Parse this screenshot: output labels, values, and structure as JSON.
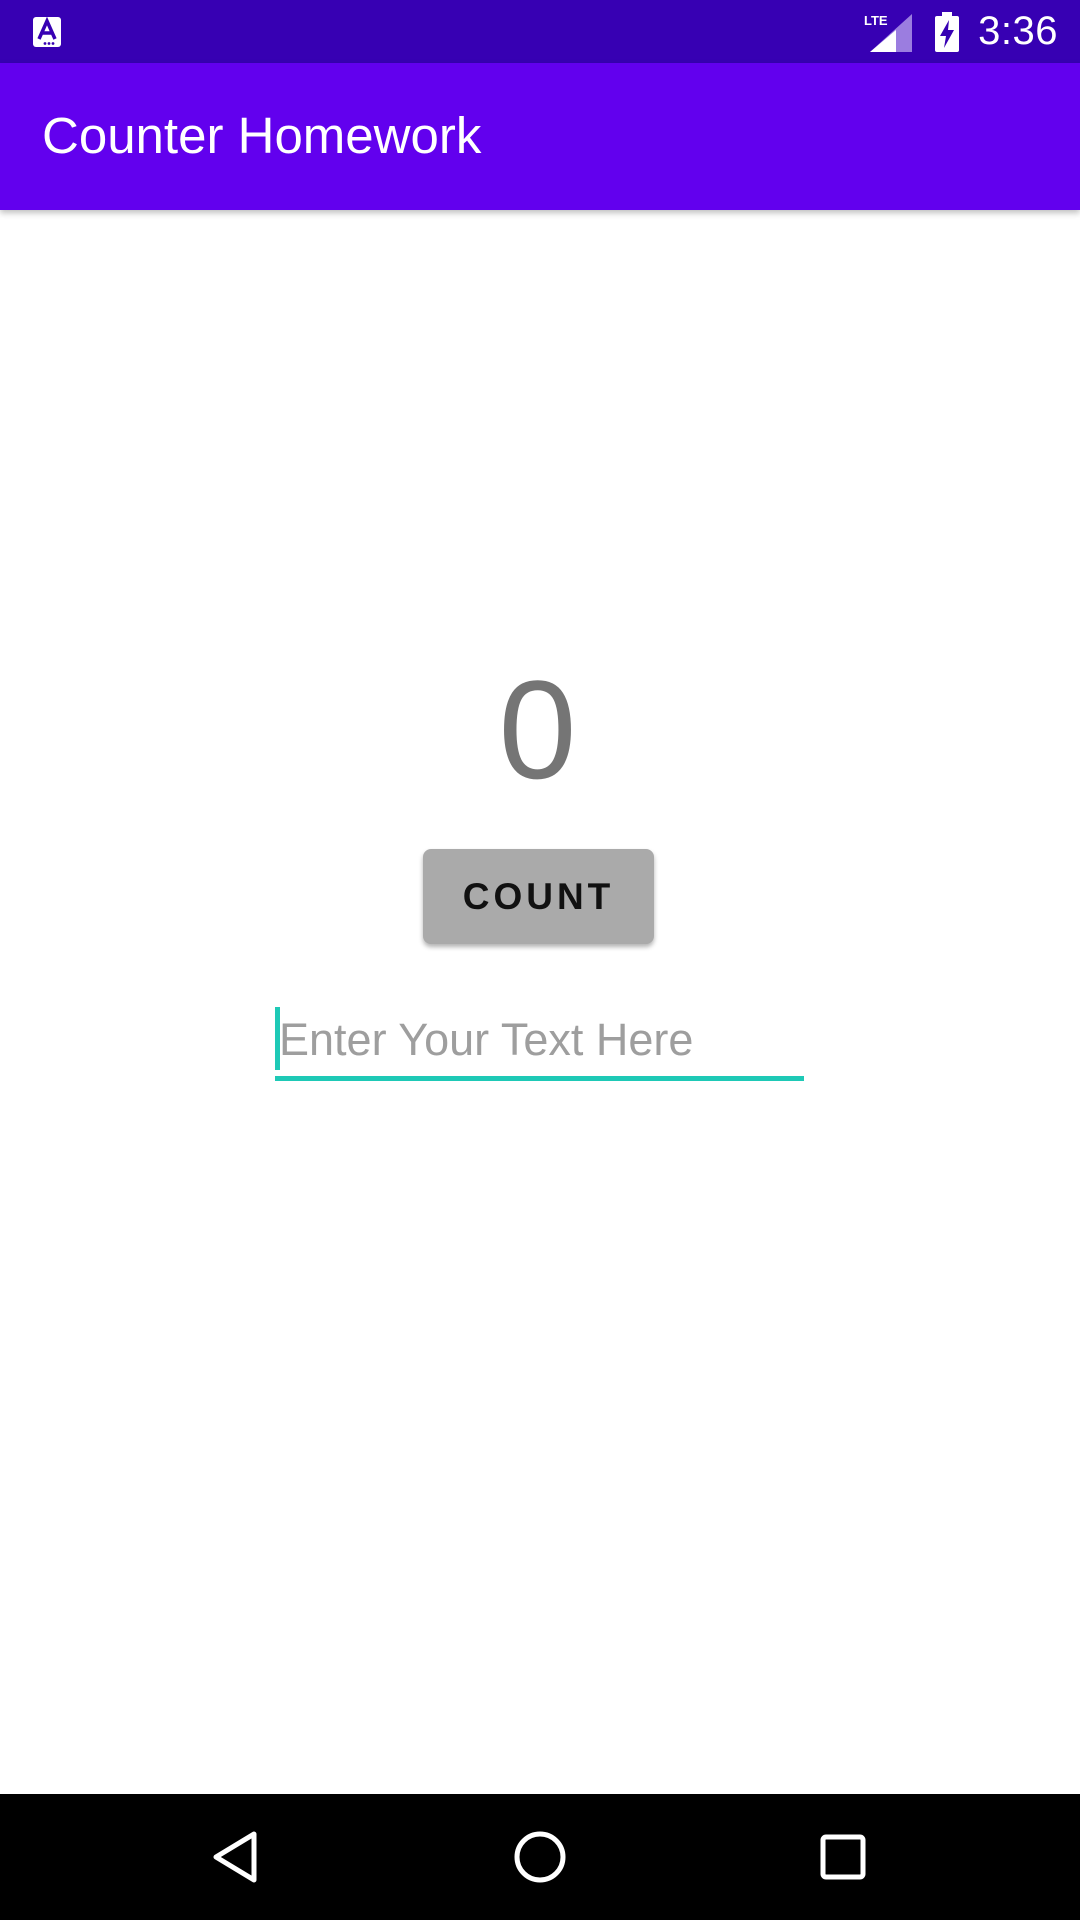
{
  "status_bar": {
    "time": "3:36",
    "network_label": "LTE",
    "icons": [
      "app-notification-icon",
      "lte-signal-icon",
      "battery-charging-icon"
    ],
    "background": "#3700b3"
  },
  "app_bar": {
    "title": "Counter Homework",
    "background": "#6200ee"
  },
  "main": {
    "count_value": "0",
    "count_button_label": "COUNT",
    "text_input": {
      "value": "",
      "placeholder": "Enter Your Text Here",
      "accent": "#1ec9b6"
    }
  },
  "nav_bar": {
    "icons": [
      "back-icon",
      "home-icon",
      "recents-icon"
    ]
  }
}
